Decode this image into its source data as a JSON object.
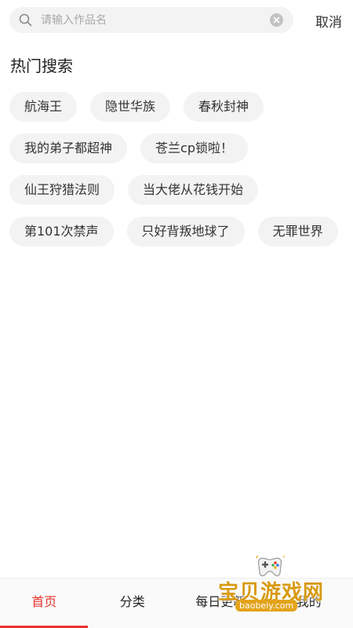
{
  "search": {
    "placeholder": "请输入作品名",
    "value": "",
    "cancel_label": "取消"
  },
  "hot": {
    "title": "热门搜索",
    "tags": [
      "航海王",
      "隐世华族",
      "春秋封神",
      "我的弟子都超神",
      "苍兰cp锁啦！",
      "仙王狩猎法则",
      "当大佬从花钱开始",
      "第101次禁声",
      "只好背叛地球了",
      "无罪世界"
    ]
  },
  "nav": {
    "items": [
      "首页",
      "分类",
      "每日更新",
      "我的"
    ],
    "active_index": 0
  },
  "watermark": {
    "title": "宝贝游戏网",
    "url": "baobeiy.com"
  },
  "colors": {
    "accent": "#e8322d",
    "tag_bg": "#f3f3f3",
    "watermark": "#d89a12"
  }
}
